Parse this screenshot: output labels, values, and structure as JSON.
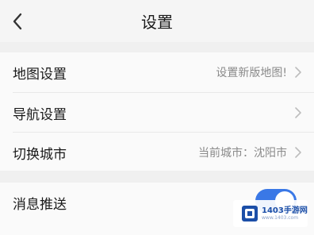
{
  "header": {
    "title": "设置"
  },
  "settings": {
    "map_label": "地图设置",
    "map_value": "设置新版地图!",
    "nav_label": "导航设置",
    "city_label": "切换城市",
    "city_value": "当前城市：沈阳市",
    "notify_label": "消息推送",
    "notify_enabled": true
  },
  "watermark": {
    "brand": "1403手游网",
    "url": "www.1403.com"
  },
  "colors": {
    "accent": "#3a78e6",
    "background": "#f0f0f0",
    "card": "#fafafa"
  }
}
